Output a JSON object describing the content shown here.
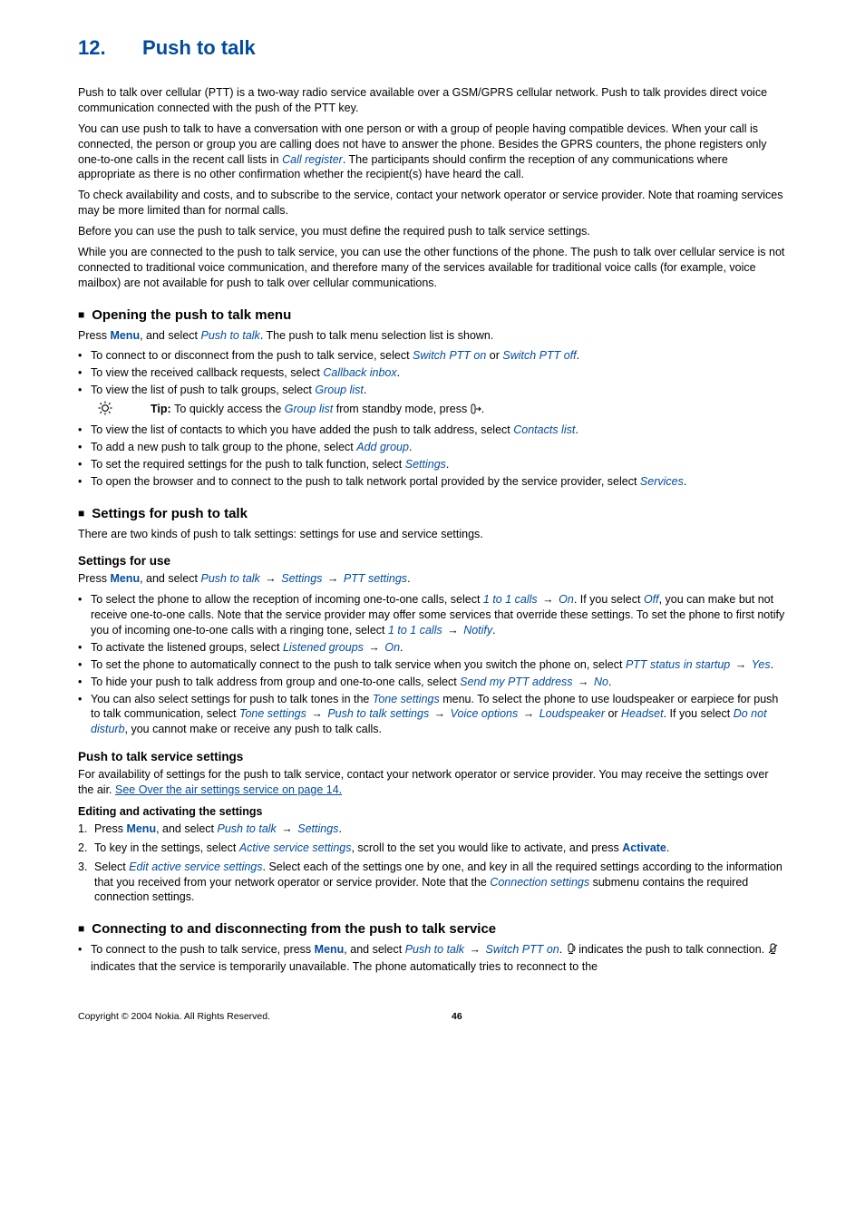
{
  "chapter": {
    "num": "12.",
    "title": "Push to talk"
  },
  "intro": {
    "p1": "Push to talk over cellular (PTT) is a two-way radio service available over a GSM/GPRS cellular network. Push to talk provides direct voice communication connected with the push of the PTT key.",
    "p2a": "You can use push to talk to have a conversation with one person or with a group of people having compatible devices. When your call is connected, the person or group you are calling does not have to answer the phone. Besides the GPRS counters, the phone registers only one-to-one calls in the recent call lists in ",
    "p2_call_register": "Call register",
    "p2b": ". The participants should confirm the reception of any communications where appropriate as there is no other confirmation whether the recipient(s) have heard the call.",
    "p3": "To check availability and costs, and to subscribe to the service, contact your network operator or service provider. Note that roaming services may be more limited than for normal calls.",
    "p4": "Before you can use the push to talk service, you must define the required push to talk service settings.",
    "p5": "While you are connected to the push to talk service, you can use the other functions of the phone. The push to talk over cellular service is not connected to traditional voice communication, and therefore many of the services available for traditional voice calls (for example, voice mailbox) are not available for push to talk over cellular communications."
  },
  "s_open": {
    "title": "Opening the push to talk menu",
    "lead_a": "Press ",
    "menu": "Menu",
    "lead_b": ", and select ",
    "ptt": "Push to talk",
    "lead_c": ". The push to talk menu selection list is shown.",
    "b1a": "To connect to or disconnect from the push to talk service, select ",
    "b1_on": "Switch PTT on",
    "b1_or": " or ",
    "b1_off": "Switch PTT off",
    "b2a": "To view the received callback requests, select ",
    "b2_cb": "Callback inbox",
    "b3a": "To view the list of push to talk groups, select ",
    "b3_gl": "Group list",
    "tip_bold": "Tip: ",
    "tip_a": "To quickly access the ",
    "tip_gl": "Group list",
    "tip_b": " from standby mode, press ",
    "b4a": "To view the list of contacts to which you have added the push to talk address, select ",
    "b4_cl": "Contacts list",
    "b5a": "To add a new push to talk group to the phone, select ",
    "b5_ag": "Add group",
    "b6a": "To set the required settings for the push to talk function, select ",
    "b6_s": "Settings",
    "b7a": "To open the browser and to connect to the push to talk network portal provided by the service provider, select ",
    "b7_sv": "Services"
  },
  "s_set": {
    "title": "Settings for push to talk",
    "lead": "There are two kinds of push to talk settings: settings for use and service settings.",
    "use_title": "Settings for use",
    "use_lead_a": "Press ",
    "use_menu": "Menu",
    "use_lead_b": ", and select ",
    "use_ptt": "Push to talk",
    "use_settings": "Settings",
    "use_pttset": "PTT settings",
    "ub1a": "To select the phone to allow the reception of incoming one-to-one calls, select ",
    "ub1_1to1": "1 to 1 calls",
    "ub1_on": "On",
    "ub1b": ". If you select ",
    "ub1_off": "Off",
    "ub1c": ", you can make but not receive one-to-one calls. Note that the service provider may offer some services that override these settings. To set the phone to first notify you of incoming one-to-one calls with a ringing tone, select ",
    "ub1_notify": "Notify",
    "ub2a": "To activate the listened groups, select ",
    "ub2_lg": "Listened groups",
    "ub2_on": "On",
    "ub3a": "To set the phone to automatically connect to the push to talk service when you switch the phone on, select ",
    "ub3_status": "PTT status in startup",
    "ub3_yes": "Yes",
    "ub4a": "To hide your push to talk address from group and one-to-one calls, select ",
    "ub4_send": "Send my PTT address",
    "ub4_no": "No",
    "ub5a": "You can also select settings for push to talk tones in the ",
    "ub5_tone": "Tone settings",
    "ub5b": " menu. To select the phone to use loudspeaker or earpiece for push to talk communication, select ",
    "ub5_pttset": "Push to talk settings",
    "ub5_voice": "Voice options",
    "ub5_loud": "Loudspeaker",
    "ub5_or": " or ",
    "ub5_head": "Headset",
    "ub5c": ". If you select ",
    "ub5_dnd": "Do not disturb",
    "ub5d": ", you cannot make or receive any push to talk calls.",
    "svc_title": "Push to talk service settings",
    "svc_lead": "For availability of settings for the push to talk service, contact your network operator or service provider. You may receive the settings over the air. ",
    "svc_link": "See Over the air settings service on page 14.",
    "edit_title": "Editing and activating the settings",
    "st1a": "Press ",
    "st1_menu": "Menu",
    "st1b": ", and select ",
    "st1_ptt": "Push to talk",
    "st1_set": "Settings",
    "st2a": "To key in the settings, select ",
    "st2_ass": "Active service settings",
    "st2b": ", scroll to the set you would like to activate, and press ",
    "st2_act": "Activate",
    "st3a": "Select ",
    "st3_eass": "Edit active service settings",
    "st3b": ". Select each of the settings one by one, and key in all the required settings according to the information that you received from your network operator or service provider. Note that the ",
    "st3_conn": "Connection settings",
    "st3c": " submenu contains the required connection settings."
  },
  "s_conn": {
    "title": "Connecting to and disconnecting from the push to talk service",
    "b1a": "To connect to the push to talk service, press ",
    "b1_menu": "Menu",
    "b1b": ", and select ",
    "b1_ptt": "Push to talk",
    "b1_on": "Switch PTT on",
    "b1c": ". ",
    "b1d": " indicates the push to talk connection. ",
    "b1e": " indicates that the service is temporarily unavailable. The phone automatically tries to reconnect to the"
  },
  "footer": {
    "copy": "Copyright © 2004 Nokia. All Rights Reserved.",
    "page": "46"
  }
}
